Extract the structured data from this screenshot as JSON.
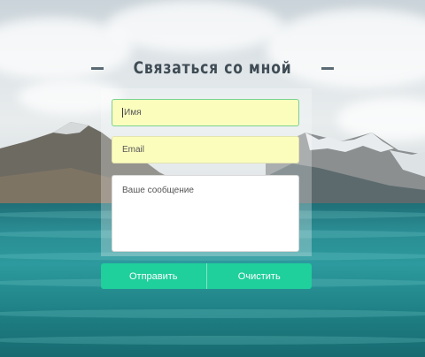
{
  "title": "Связаться со мной",
  "form": {
    "name_placeholder": "Имя",
    "email_placeholder": "Email",
    "message_placeholder": "Ваше сообщение"
  },
  "buttons": {
    "send": "Отправить",
    "clear": "Очистить"
  },
  "colors": {
    "accent": "#1fcf9c",
    "field_fill": "#fbfdbd",
    "title": "#3f4c55",
    "focus_border": "#7ad38f"
  }
}
